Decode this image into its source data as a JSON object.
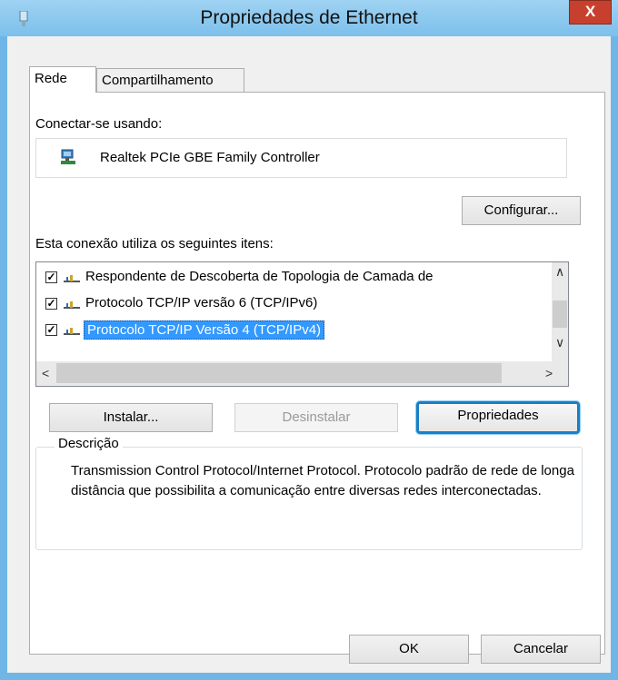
{
  "window": {
    "title": "Propriedades de Ethernet",
    "close_label": "X"
  },
  "tabs": [
    {
      "label": "Rede"
    },
    {
      "label": "Compartilhamento"
    }
  ],
  "connect_using": {
    "label": "Conectar-se usando:",
    "adapter_name": "Realtek PCIe GBE Family Controller",
    "configure_button": "Configurar..."
  },
  "items_section": {
    "label": "Esta conexão utiliza os seguintes itens:",
    "items": [
      {
        "label": "Respondente de Descoberta de Topologia de Camada de",
        "checked": true,
        "selected": false
      },
      {
        "label": "Protocolo TCP/IP versão 6 (TCP/IPv6)",
        "checked": true,
        "selected": false
      },
      {
        "label": "Protocolo TCP/IP Versão 4 (TCP/IPv4)",
        "checked": true,
        "selected": true
      }
    ]
  },
  "actions": {
    "install": "Instalar...",
    "uninstall": "Desinstalar",
    "properties": "Propriedades"
  },
  "description": {
    "title": "Descrição",
    "text": "Transmission Control Protocol/Internet Protocol. Protocolo padrão de rede de longa distância que possibilita a comunicação entre diversas redes interconectadas."
  },
  "footer": {
    "ok": "OK",
    "cancel": "Cancelar"
  },
  "colors": {
    "titlebar": "#7cc0ec",
    "close": "#c7402e",
    "selection": "#3399ff",
    "focus_border": "#1a7fc2"
  }
}
